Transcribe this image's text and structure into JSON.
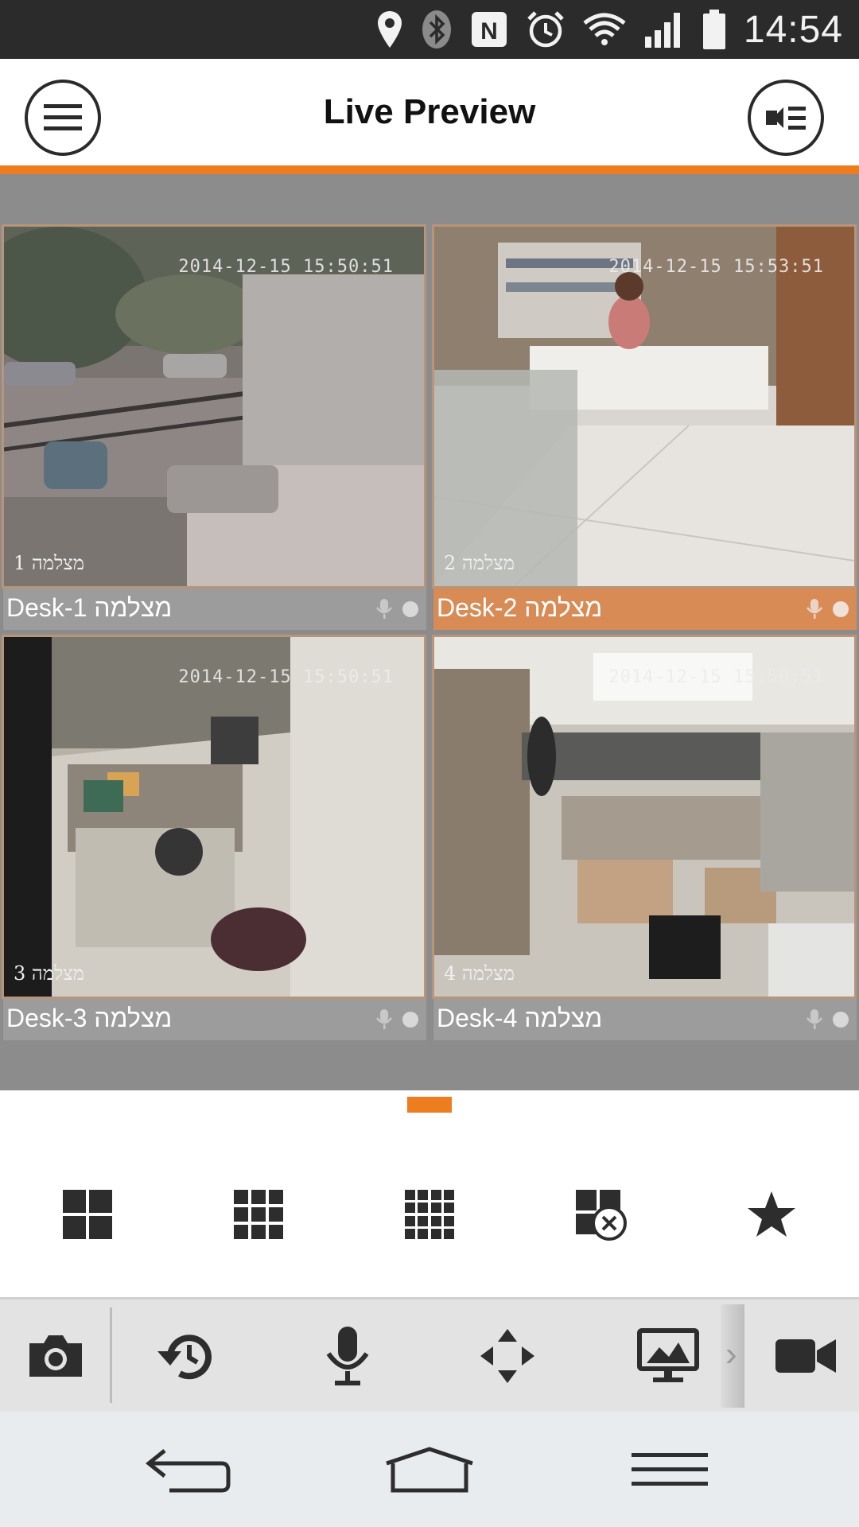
{
  "status_bar": {
    "time": "14:54",
    "icons": [
      "location-icon",
      "bluetooth-icon",
      "nfc-icon",
      "alarm-icon",
      "wifi-icon",
      "signal-icon",
      "battery-icon"
    ]
  },
  "header": {
    "title": "Live Preview",
    "left_icon": "hamburger-menu-icon",
    "right_icon": "camera-list-icon"
  },
  "colors": {
    "accent": "#ee7d1f",
    "selected_label": "#d98b56",
    "label_bar": "#9c9c9c",
    "grid_bg": "#8c8c8c"
  },
  "cameras": [
    {
      "label": "Desk-1 מצלמה",
      "timestamp": "2014-12-15 15:50:51",
      "overlay": "1 מצלמה",
      "selected": false
    },
    {
      "label": "Desk-2 מצלמה",
      "timestamp": "2014-12-15 15:53:51",
      "overlay": "2 מצלמה",
      "selected": true
    },
    {
      "label": "Desk-3 מצלמה",
      "timestamp": "2014-12-15 15:50:51",
      "overlay": "3 מצלמה",
      "selected": false
    },
    {
      "label": "Desk-4 מצלמה",
      "timestamp": "2014-12-15 15:50:51",
      "overlay": "4 מצלמה",
      "selected": false
    }
  ],
  "layout_options": [
    "grid-2x2-icon",
    "grid-3x3-icon",
    "grid-4x4-icon",
    "close-all-icon",
    "favorite-star-icon"
  ],
  "toolbar": [
    "snapshot-camera-icon",
    "playback-history-icon",
    "microphone-icon",
    "ptz-arrows-icon",
    "image-adjust-icon",
    "record-video-icon"
  ],
  "nav": [
    "back-icon",
    "home-icon",
    "menu-icon"
  ]
}
